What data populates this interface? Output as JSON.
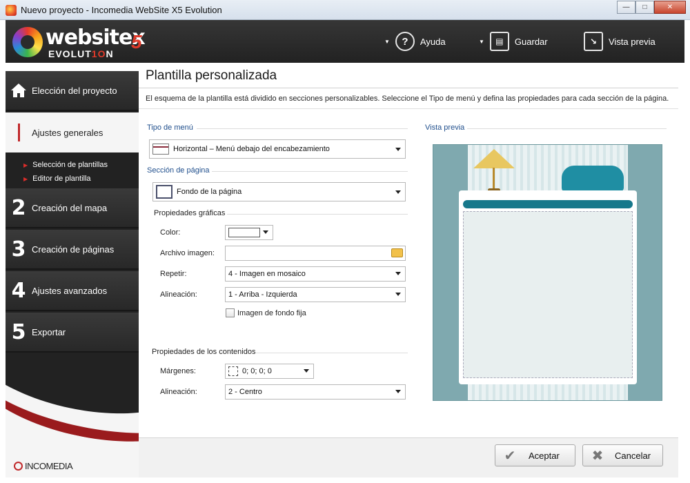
{
  "window": {
    "title": "Nuevo proyecto - Incomedia WebSite X5 Evolution"
  },
  "logo": {
    "word": "websitex",
    "x5": "5",
    "sub_a": "EVOLUT",
    "sub_b": "1O",
    "sub_c": "N"
  },
  "header": {
    "help_label": "Ayuda",
    "save_label": "Guardar",
    "preview_label": "Vista previa"
  },
  "sidebar": {
    "items": [
      {
        "num": "",
        "label": "Elección del proyecto"
      },
      {
        "num": "",
        "label": "Ajustes generales"
      },
      {
        "num": "2",
        "label": "Creación del mapa"
      },
      {
        "num": "3",
        "label": "Creación de páginas"
      },
      {
        "num": "4",
        "label": "Ajustes avanzados"
      },
      {
        "num": "5",
        "label": "Exportar"
      }
    ],
    "subitems": [
      {
        "label": "Selección de plantillas"
      },
      {
        "label": "Editor de plantilla"
      }
    ],
    "brand": "INCOMEDIA"
  },
  "panel": {
    "title": "Plantilla personalizada",
    "description": "El esquema de la plantilla está dividido en secciones personalizables. Seleccione el Tipo de menú y defina las propiedades para cada sección de la página.",
    "menu_type_label": "Tipo de menú",
    "menu_type_value": "Horizontal – Menú debajo del encabezamiento",
    "page_section_label": "Sección de página",
    "page_section_value": "Fondo de la página",
    "graphic_props_label": "Propiedades gráficas",
    "color_label": "Color:",
    "image_file_label": "Archivo imagen:",
    "image_file_value": "",
    "repeat_label": "Repetir:",
    "repeat_value": "4 - Imagen en mosaico",
    "alignment_label": "Alineación:",
    "alignment_value": "1 - Arriba - Izquierda",
    "fixed_bg_label": "Imagen de fondo fija",
    "fixed_bg_checked": false,
    "content_props_label": "Propiedades de los contenidos",
    "margins_label": "Márgenes:",
    "margins_value": "0; 0; 0; 0",
    "content_alignment_label": "Alineación:",
    "content_alignment_value": "2 - Centro",
    "preview_label": "Vista previa"
  },
  "footer": {
    "accept_label": "Aceptar",
    "cancel_label": "Cancelar"
  },
  "colors": {
    "accent_red": "#c0282a",
    "section_blue": "#1f4e8c",
    "preview_teal": "#7fa9af"
  }
}
